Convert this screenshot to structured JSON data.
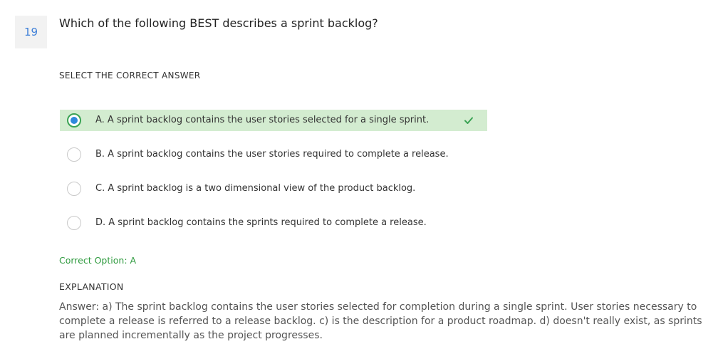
{
  "question": {
    "number": "19",
    "text": "Which of the following BEST describes a sprint backlog?"
  },
  "select_label": "SELECT THE CORRECT ANSWER",
  "options": [
    {
      "text": "A. A sprint backlog contains the user stories selected for a single sprint.",
      "selected": true,
      "correct": true
    },
    {
      "text": "B. A sprint backlog contains the user stories required to complete a release.",
      "selected": false,
      "correct": false
    },
    {
      "text": "C. A sprint backlog is a two dimensional view of the product backlog.",
      "selected": false,
      "correct": false
    },
    {
      "text": "D. A sprint backlog contains the sprints required to complete a release.",
      "selected": false,
      "correct": false
    }
  ],
  "correct_option": "Correct Option: A",
  "explanation": {
    "label": "EXPLANATION",
    "text": "Answer: a) The sprint backlog contains the user stories selected for completion during a single sprint. User stories necessary to complete a release is referred to a release backlog. c) is the description for a product roadmap. d) doesn't really exist, as sprints are planned incrementally as the project progresses."
  },
  "colors": {
    "accent": "#3f80d8",
    "correct_bg": "#d3ecd0",
    "correct_text": "#2e9a3e"
  },
  "icons": {
    "correct_check": "check-icon"
  }
}
